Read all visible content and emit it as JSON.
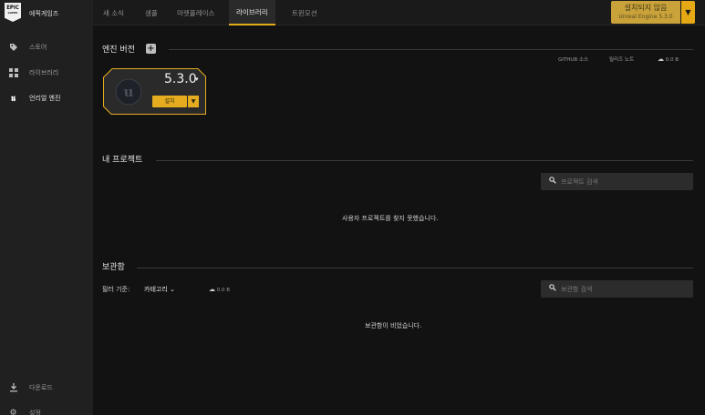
{
  "sidebar": {
    "brand_logo": "EPIC GAMES",
    "brand_label": "에픽게임즈",
    "items": [
      {
        "icon": "tag-icon",
        "label": "스토어"
      },
      {
        "icon": "grid-icon",
        "label": "라이브러리"
      },
      {
        "icon": "unreal-icon",
        "label": "언리얼 엔진"
      }
    ],
    "bottom_items": [
      {
        "icon": "download-icon",
        "label": "다운로드"
      },
      {
        "icon": "gear-icon",
        "label": "설정"
      }
    ]
  },
  "topbar": {
    "tabs": [
      "새 소식",
      "샘플",
      "마켓플레이스",
      "라이브러리",
      "트윈모션"
    ],
    "active_tab": "라이브러리",
    "install_button": {
      "label": "설치되지 않음",
      "sublabel": "Unreal Engine 5.3.0"
    },
    "accent_color": "#e4ac1e"
  },
  "engine": {
    "title": "엔진 버전",
    "links": {
      "github": "GITHUB 소스",
      "release_notes": "릴리즈 노트",
      "size": "0.0 B"
    },
    "card": {
      "version": "5.3.0",
      "install_label": "설치"
    }
  },
  "projects": {
    "title": "내 프로젝트",
    "search_placeholder": "프로젝트 검색",
    "empty_message": "사용자 프로젝트를 찾지 못했습니다."
  },
  "vault": {
    "title": "보관함",
    "filter_label": "필터 기준:",
    "filter_value": "카테고리",
    "size": "0.0 B",
    "search_placeholder": "보관함 검색",
    "empty_message": "보관함이 비었습니다."
  }
}
